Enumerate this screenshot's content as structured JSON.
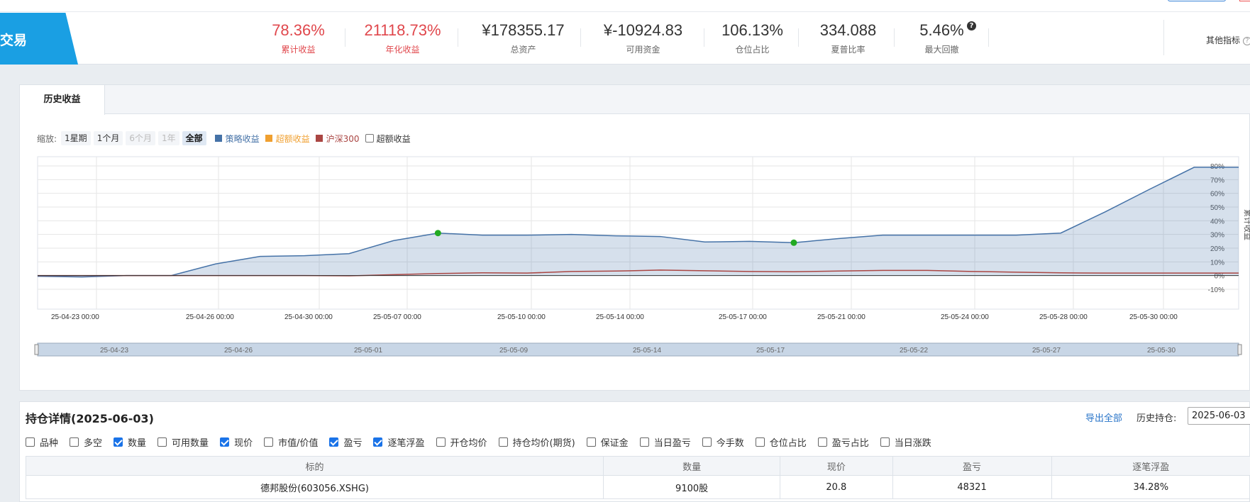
{
  "header": {
    "brand": "交易",
    "metrics": [
      {
        "value": "78.36%",
        "label": "累计收益",
        "color": "red"
      },
      {
        "value": "21118.73%",
        "label": "年化收益",
        "color": "red"
      },
      {
        "value": "¥178355.17",
        "label": "总资产",
        "color": "normal"
      },
      {
        "value": "¥-10924.83",
        "label": "可用资金",
        "color": "normal"
      },
      {
        "value": "106.13%",
        "label": "仓位占比",
        "color": "normal"
      },
      {
        "value": "334.088",
        "label": "夏普比率",
        "color": "normal"
      },
      {
        "value": "5.46%",
        "label": "最大回撤",
        "color": "normal"
      }
    ],
    "info_icon": "?",
    "other_indicators": "其他指标",
    "other_help": "?"
  },
  "chart_panel": {
    "tab_label": "历史收益",
    "zoom_label": "缩放:",
    "zoom_buttons": [
      {
        "label": "1星期",
        "state": "normal"
      },
      {
        "label": "1个月",
        "state": "normal"
      },
      {
        "label": "6个月",
        "state": "disabled"
      },
      {
        "label": "1年",
        "state": "disabled"
      },
      {
        "label": "全部",
        "state": "active"
      }
    ],
    "legend": [
      {
        "label": "策略收益",
        "color": "#4572a7"
      },
      {
        "label": "超额收益",
        "color": "#f0a030"
      },
      {
        "label": "沪深300",
        "color": "#aa4643"
      }
    ],
    "excess_checkbox_label": "超额收益",
    "excess_checked": false
  },
  "chart_data": {
    "type": "line",
    "ylabel": "累计收益",
    "ylim": [
      -10,
      80
    ],
    "yticks": [
      "80%",
      "70%",
      "60%",
      "50%",
      "40%",
      "30%",
      "20%",
      "10%",
      "0%",
      "-10%"
    ],
    "x_tick_labels": [
      "25-04-23 00:00",
      "25-04-26 00:00",
      "25-04-30 00:00",
      "25-05-07 00:00",
      "25-05-10 00:00",
      "25-05-14 00:00",
      "25-05-17 00:00",
      "25-05-21 00:00",
      "25-05-24 00:00",
      "25-05-28 00:00",
      "25-05-30 00:00"
    ],
    "navigator_labels": [
      "25-04-23",
      "25-04-26",
      "25-05-01",
      "25-05-09",
      "25-05-14",
      "25-05-17",
      "25-05-22",
      "25-05-27",
      "25-05-30"
    ],
    "series": [
      {
        "name": "策略收益",
        "color": "#4572a7",
        "values": [
          -0.5,
          -1,
          0,
          0,
          8.5,
          14,
          14.5,
          16,
          25.5,
          31,
          29.5,
          29.5,
          30,
          29,
          28.5,
          24.5,
          25,
          24,
          27,
          29.5,
          29.5,
          29.5,
          29.5,
          31,
          46.5,
          63,
          79,
          79
        ]
      },
      {
        "name": "沪深300",
        "color": "#aa4643",
        "values": [
          0,
          0,
          0,
          0,
          0,
          0,
          0,
          -0.2,
          0.7,
          1.5,
          2,
          1.8,
          3,
          3.3,
          4,
          3.5,
          3,
          2.8,
          3.3,
          3.8,
          3.8,
          3,
          2.5,
          2,
          1.8,
          1.8,
          1.8,
          1.8
        ]
      }
    ],
    "markers": [
      {
        "series": "策略收益",
        "index": 9,
        "value": 31,
        "color": "#22aa22"
      },
      {
        "series": "策略收益",
        "index": 17,
        "value": 24,
        "color": "#22aa22"
      }
    ]
  },
  "holdings": {
    "title": "持仓详情(2025-06-03)",
    "export_all": "导出全部",
    "history_label": "历史持仓:",
    "history_date": "2025-06-03",
    "column_options": [
      {
        "label": "品种",
        "checked": false
      },
      {
        "label": "多空",
        "checked": false
      },
      {
        "label": "数量",
        "checked": true
      },
      {
        "label": "可用数量",
        "checked": false
      },
      {
        "label": "现价",
        "checked": true
      },
      {
        "label": "市值/价值",
        "checked": false
      },
      {
        "label": "盈亏",
        "checked": true
      },
      {
        "label": "逐笔浮盈",
        "checked": true
      },
      {
        "label": "开仓均价",
        "checked": false
      },
      {
        "label": "持仓均价(期货)",
        "checked": false
      },
      {
        "label": "保证金",
        "checked": false
      },
      {
        "label": "当日盈亏",
        "checked": false
      },
      {
        "label": "今手数",
        "checked": false
      },
      {
        "label": "仓位占比",
        "checked": false
      },
      {
        "label": "盈亏占比",
        "checked": false
      },
      {
        "label": "当日涨跌",
        "checked": false
      }
    ],
    "table": {
      "headers": [
        "标的",
        "数量",
        "现价",
        "盈亏",
        "逐笔浮盈"
      ],
      "rows": [
        [
          "德邦股份(603056.XSHG)",
          "9100股",
          "20.8",
          "48321",
          "34.28%"
        ]
      ]
    }
  }
}
